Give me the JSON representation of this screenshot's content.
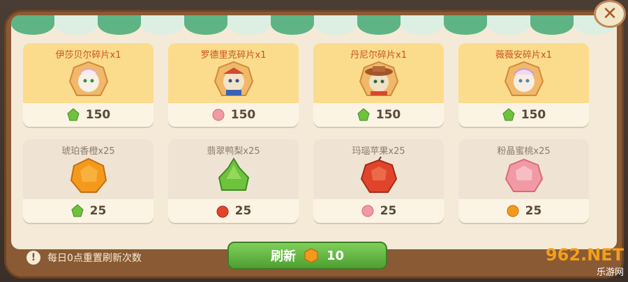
{
  "hero_cards": [
    {
      "name": "伊莎贝尔碎片x1",
      "price": "150",
      "currency": "green-gem-icon"
    },
    {
      "name": "罗德里克碎片x1",
      "price": "150",
      "currency": "pink-gem-icon"
    },
    {
      "name": "丹尼尔碎片x1",
      "price": "150",
      "currency": "green-gem-icon"
    },
    {
      "name": "薇薇安碎片x1",
      "price": "150",
      "currency": "green-gem-icon"
    }
  ],
  "fruit_cards": [
    {
      "name": "琥珀香橙x25",
      "price": "25",
      "currency": "green-gem-icon"
    },
    {
      "name": "翡翠鸭梨x25",
      "price": "25",
      "currency": "red-gem-icon"
    },
    {
      "name": "玛瑙苹果x25",
      "price": "25",
      "currency": "pink-gem-icon"
    },
    {
      "name": "粉晶蜜桃x25",
      "price": "25",
      "currency": "orange-gem-icon"
    }
  ],
  "footer": {
    "note": "每日0点重置刷新次数",
    "refresh_label": "刷新",
    "refresh_cost": "10"
  },
  "watermark": {
    "logo": "962.NET",
    "sub": "乐游网"
  },
  "colors": {
    "green": "#6fc23c",
    "pink": "#f19aa6",
    "red": "#e0452c",
    "orange": "#f39a1d"
  }
}
